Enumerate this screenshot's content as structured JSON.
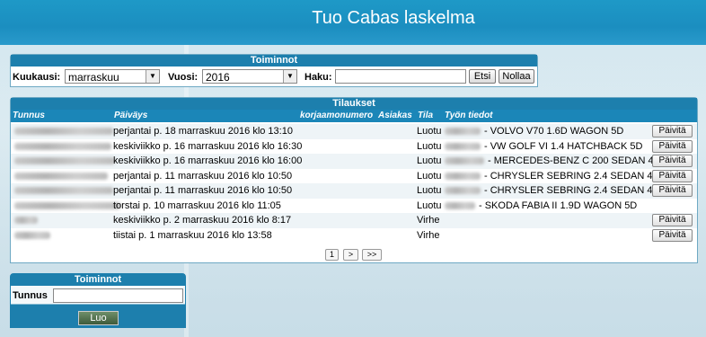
{
  "header": {
    "title": "Tuo Cabas laskelma"
  },
  "tools": {
    "title": "Toiminnot",
    "month_label": "Kuukausi:",
    "month_value": "marraskuu",
    "year_label": "Vuosi:",
    "year_value": "2016",
    "search_label": "Haku:",
    "search_value": "",
    "search_button": "Etsi",
    "reset_button": "Nollaa"
  },
  "orders": {
    "title": "Tilaukset",
    "columns": {
      "id": "Tunnus",
      "date": "Päiväys",
      "repair_no": "korjaamonumero",
      "customer": "Asiakas",
      "status": "Tila",
      "work": "Työn tiedot"
    },
    "update_label": "Päivitä",
    "rows": [
      {
        "date": "perjantai p. 18 marraskuu 2016 klo 13:10",
        "status": "Luotu",
        "work": "- VOLVO V70 1.6D WAGON 5D",
        "has_button": true
      },
      {
        "date": "keskiviikko p. 16 marraskuu 2016 klo 16:30",
        "status": "Luotu",
        "work": "- VW GOLF VI 1.4 HATCHBACK 5D",
        "has_button": true
      },
      {
        "date": "keskiviikko p. 16 marraskuu 2016 klo 16:00",
        "status": "Luotu",
        "work": "- MERCEDES-BENZ C 200 SEDAN 4D",
        "has_button": true
      },
      {
        "date": "perjantai p. 11 marraskuu 2016 klo 10:50",
        "status": "Luotu",
        "work": "- CHRYSLER SEBRING 2.4 SEDAN 4D",
        "has_button": true
      },
      {
        "date": "perjantai p. 11 marraskuu 2016 klo 10:50",
        "status": "Luotu",
        "work": "- CHRYSLER SEBRING 2.4 SEDAN 4D",
        "has_button": true
      },
      {
        "date": "torstai p. 10 marraskuu 2016 klo 11:05",
        "status": "Luotu",
        "work": "- SKODA FABIA II 1.9D WAGON 5D",
        "has_button": false
      },
      {
        "date": "keskiviikko p. 2 marraskuu 2016 klo 8:17",
        "status": "Virhe",
        "work": "",
        "has_button": true
      },
      {
        "date": "tiistai p. 1 marraskuu 2016 klo 13:58",
        "status": "Virhe",
        "work": "",
        "has_button": true
      }
    ],
    "pager": {
      "first": "1",
      "next": ">",
      "last": ">>"
    }
  },
  "create": {
    "title": "Toiminnot",
    "id_label": "Tunnus",
    "id_value": "",
    "create_button": "Luo"
  }
}
